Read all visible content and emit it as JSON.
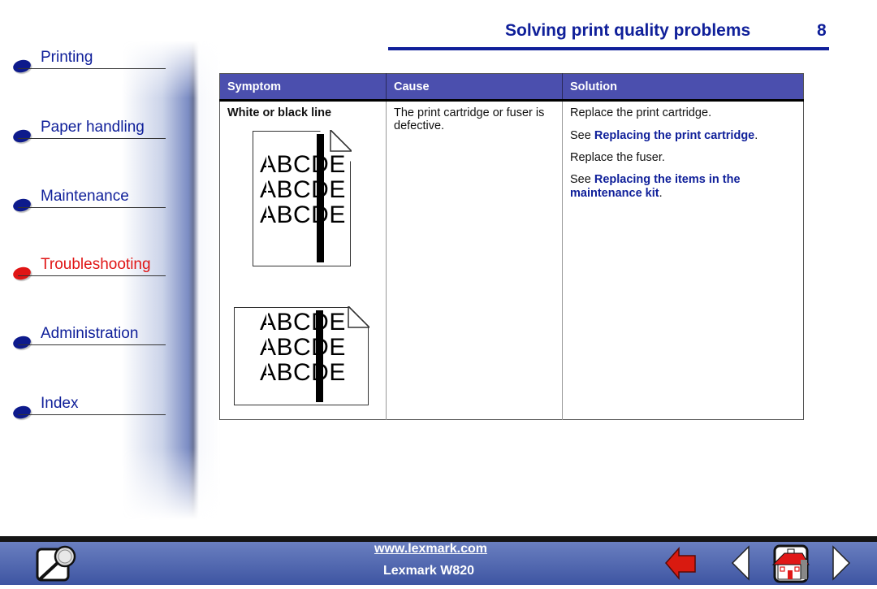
{
  "sidebar": {
    "items": [
      {
        "label": "Printing",
        "active": false
      },
      {
        "label": "Paper handling",
        "active": false
      },
      {
        "label": "Maintenance",
        "active": false
      },
      {
        "label": "Troubleshooting",
        "active": true
      },
      {
        "label": "Administration",
        "active": false
      },
      {
        "label": "Index",
        "active": false
      }
    ]
  },
  "header": {
    "title": "Solving print quality problems",
    "page_number": "8"
  },
  "table": {
    "columns": [
      "Symptom",
      "Cause",
      "Solution"
    ],
    "rows": [
      {
        "symptom": "White or black line",
        "illustration_text": "ABCDE",
        "cause": "The print cartridge or fuser is defective.",
        "solution": {
          "step1": "Replace the print cartridge.",
          "see1_prefix": "See ",
          "see1_link": "Replacing the print cartridge",
          "see1_suffix": ".",
          "step2": "Replace the fuser.",
          "see2_prefix": "See ",
          "see2_link": "Replacing the items in the maintenance kit",
          "see2_suffix": "."
        }
      }
    ]
  },
  "footer": {
    "url": "www.lexmark.com",
    "model": "Lexmark W820",
    "icons": [
      "search-icon",
      "back-arrow-icon",
      "previous-page-icon",
      "home-icon",
      "next-page-icon"
    ]
  },
  "colors": {
    "accent": "#10209a",
    "active": "#e01515",
    "table_header": "#4b4fae"
  }
}
